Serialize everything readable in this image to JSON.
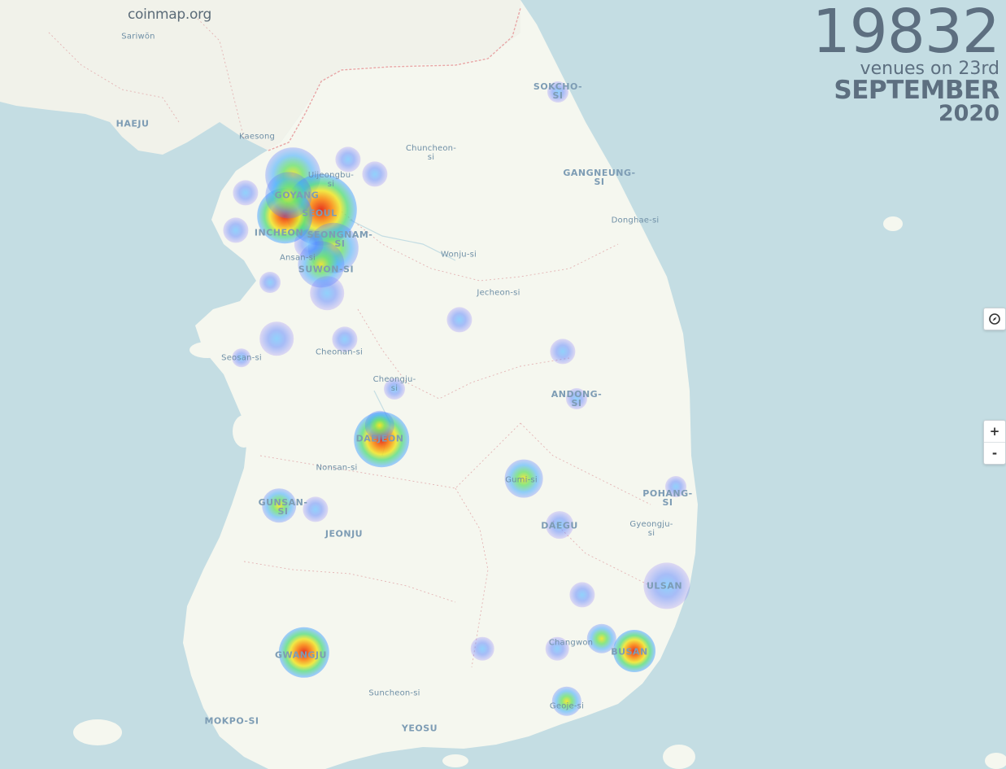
{
  "brand": "coinmap.org",
  "stats": {
    "count": "19832",
    "line1": "venues on 23rd",
    "month": "SEPTEMBER",
    "year": "2020"
  },
  "controls": {
    "zoom_in": "+",
    "zoom_out": "-"
  },
  "colors": {
    "sea": "#c4dde3",
    "land": "#f5f7ef",
    "north_land": "#f1f2ea",
    "border": "#e8a6a6",
    "label": "#6f8fa6"
  },
  "places": [
    {
      "name": "Sariwŏn",
      "big": false
    },
    {
      "name": "HAEJU",
      "big": true
    },
    {
      "name": "Kaesong",
      "big": false
    },
    {
      "name": "SOKCHO-\nSI",
      "big": true
    },
    {
      "name": "Chuncheon-\nsi",
      "big": false
    },
    {
      "name": "GANGNEUNG-\nSI",
      "big": true
    },
    {
      "name": "Donghae-si",
      "big": false
    },
    {
      "name": "Uijeongbu-\nsi",
      "big": false
    },
    {
      "name": "GOYANG",
      "big": true
    },
    {
      "name": "SEOUL",
      "big": true
    },
    {
      "name": "INCHEON",
      "big": true
    },
    {
      "name": "SEONGNAM-\nSI",
      "big": true
    },
    {
      "name": "Ansan-si",
      "big": false
    },
    {
      "name": "SUWON-SI",
      "big": true
    },
    {
      "name": "Wonju-si",
      "big": false
    },
    {
      "name": "Jecheon-si",
      "big": false
    },
    {
      "name": "Seosan-si",
      "big": false
    },
    {
      "name": "Cheonan-si",
      "big": false
    },
    {
      "name": "Cheongju-\nsi",
      "big": false
    },
    {
      "name": "ANDONG-\nSI",
      "big": true
    },
    {
      "name": "DAEJEON",
      "big": true
    },
    {
      "name": "Nonsan-si",
      "big": false
    },
    {
      "name": "Gumi-si",
      "big": false
    },
    {
      "name": "POHANG-\nSI",
      "big": true
    },
    {
      "name": "GUNSAN-\nSI",
      "big": true
    },
    {
      "name": "JEONJU",
      "big": true
    },
    {
      "name": "DAEGU",
      "big": true
    },
    {
      "name": "Gyeongju-\nsi",
      "big": false
    },
    {
      "name": "ULSAN",
      "big": true
    },
    {
      "name": "Changwon",
      "big": false
    },
    {
      "name": "BUSAN",
      "big": true
    },
    {
      "name": "GWANGJU",
      "big": true
    },
    {
      "name": "Suncheon-si",
      "big": false
    },
    {
      "name": "Geoje-si",
      "big": false
    },
    {
      "name": "MOKPO-SI",
      "big": true
    },
    {
      "name": "YEOSU",
      "big": true
    }
  ]
}
